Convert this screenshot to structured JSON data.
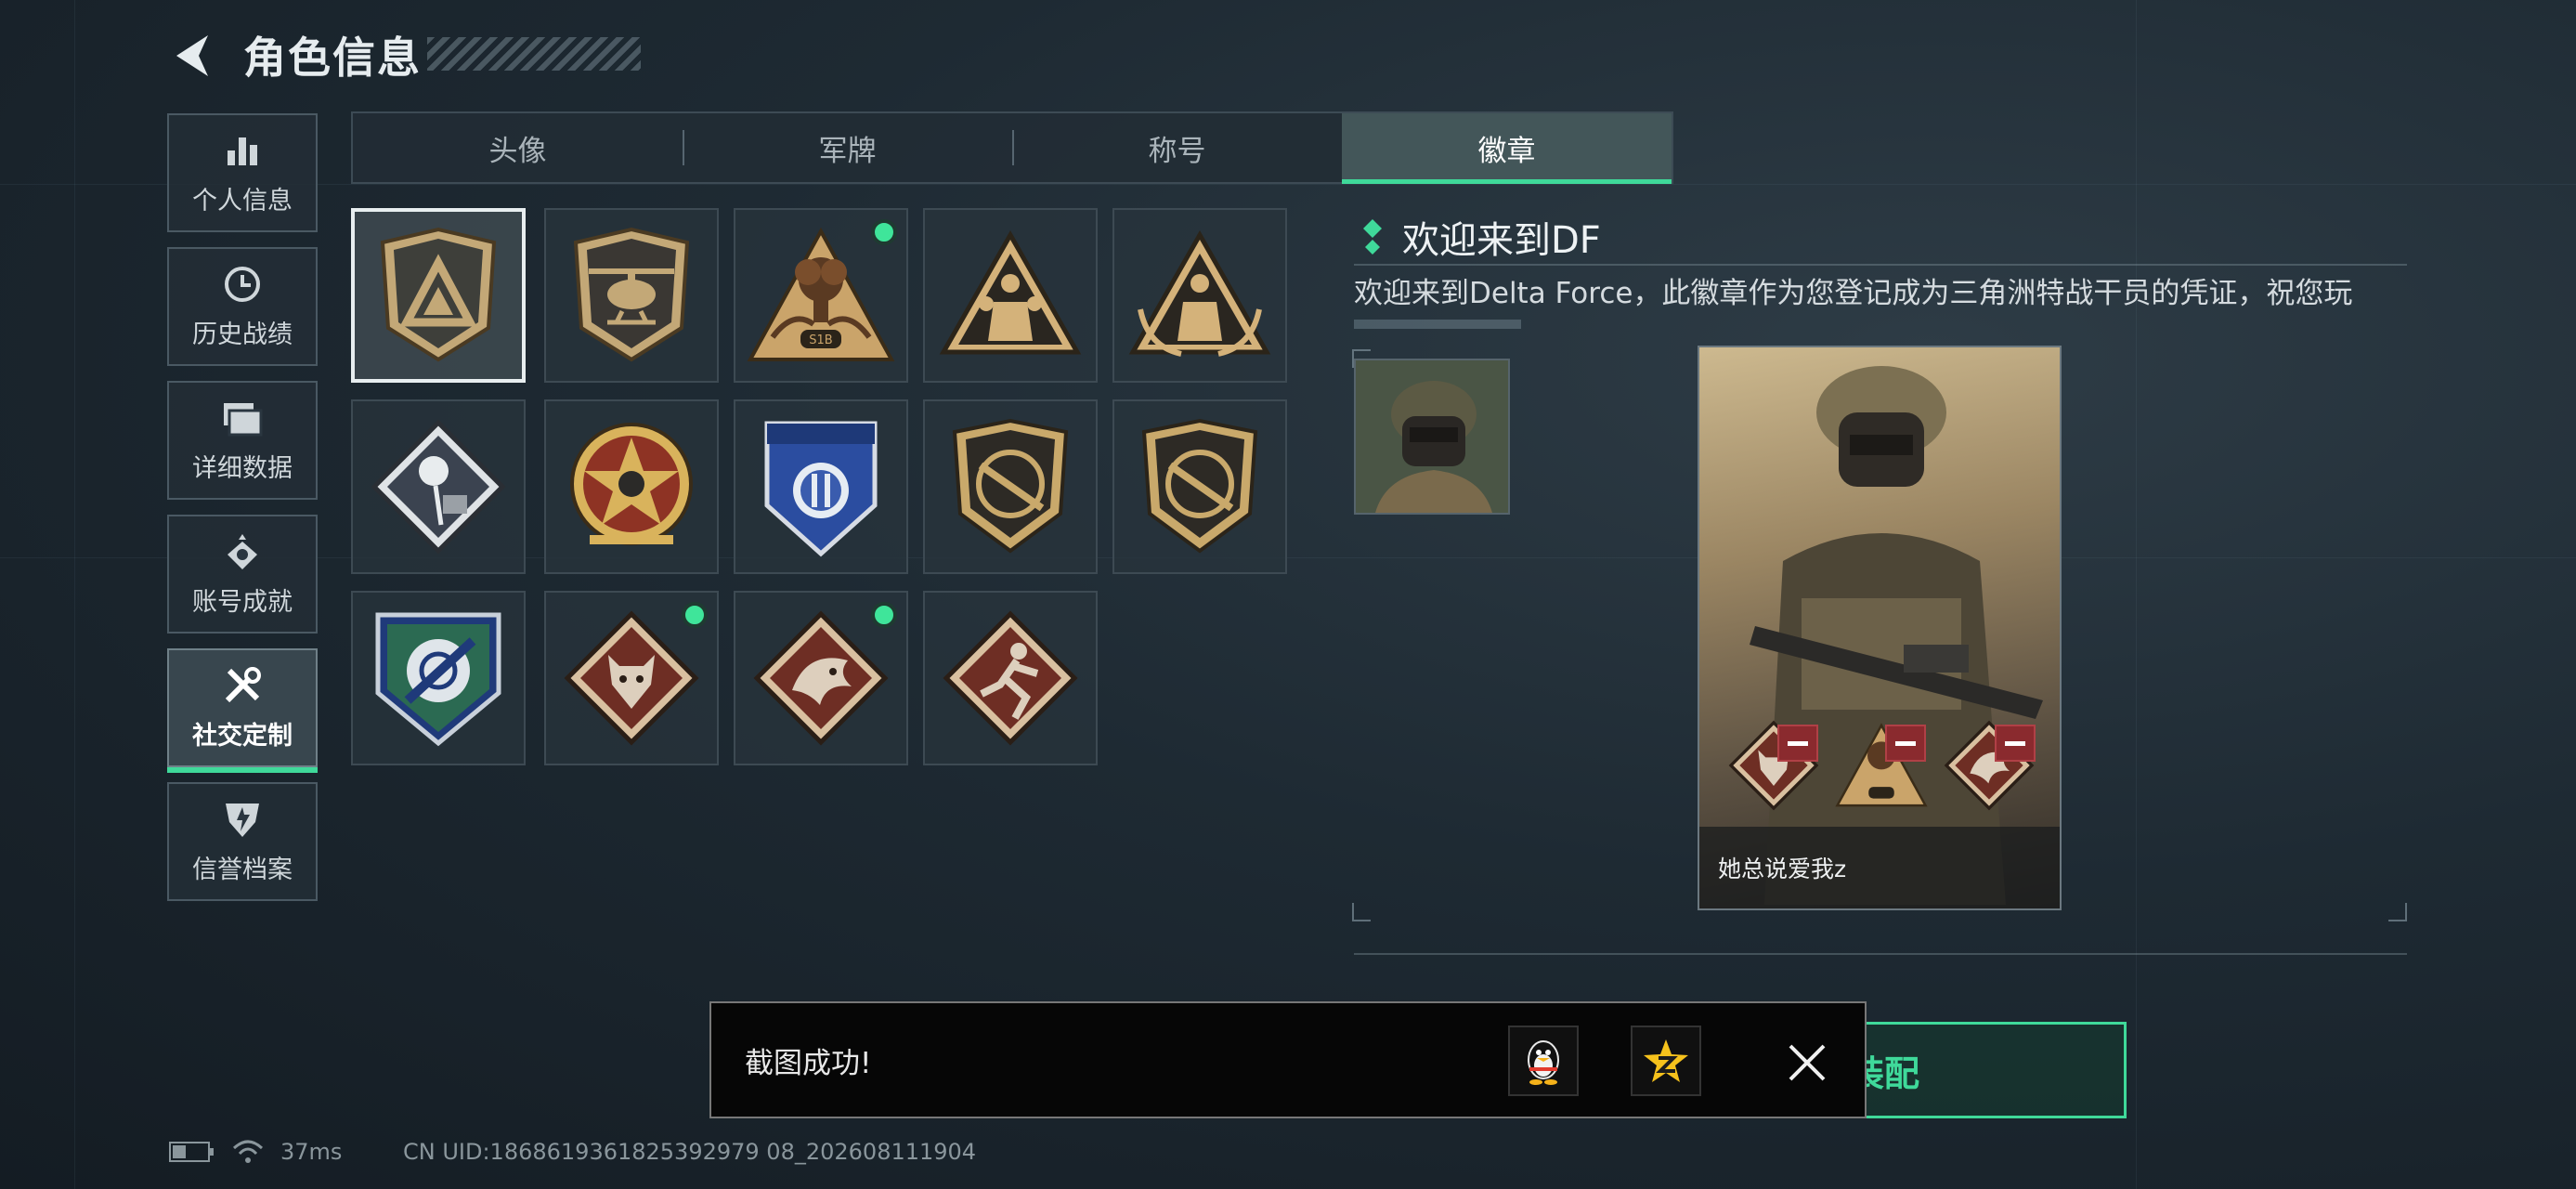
{
  "header": {
    "title": "角色信息"
  },
  "nav": [
    {
      "id": "personal",
      "label": "个人信息",
      "icon": "bar-chart-icon",
      "active": false
    },
    {
      "id": "history",
      "label": "历史战绩",
      "icon": "clock-icon",
      "active": false
    },
    {
      "id": "details",
      "label": "详细数据",
      "icon": "folder-icon",
      "active": false
    },
    {
      "id": "achievements",
      "label": "账号成就",
      "icon": "medal-icon",
      "active": false
    },
    {
      "id": "social",
      "label": "社交定制",
      "icon": "tools-icon",
      "active": true
    },
    {
      "id": "credit",
      "label": "信誉档案",
      "icon": "shield-icon",
      "active": false
    }
  ],
  "tabs": [
    {
      "label": "头像",
      "active": false
    },
    {
      "label": "军牌",
      "active": false
    },
    {
      "label": "称号",
      "active": false
    },
    {
      "label": "徽章",
      "active": true
    }
  ],
  "badges": [
    {
      "icon": "delta-triangle-shield-badge-icon",
      "selected": true,
      "new": false
    },
    {
      "icon": "helicopter-shield-badge-icon",
      "selected": false,
      "new": false
    },
    {
      "icon": "explosion-s1b-badge-icon",
      "selected": false,
      "new": true
    },
    {
      "icon": "soldiers-triangle-badge-icon",
      "selected": false,
      "new": false
    },
    {
      "icon": "soldiers-laurel-badge-icon",
      "selected": false,
      "new": false
    },
    {
      "icon": "rose-diamond-badge-icon",
      "selected": false,
      "new": false
    },
    {
      "icon": "star-roundel-badge-icon",
      "selected": false,
      "new": false
    },
    {
      "icon": "blue-shield-badge-icon",
      "selected": false,
      "new": false
    },
    {
      "icon": "rifle-shield-badge-icon",
      "selected": false,
      "new": false
    },
    {
      "icon": "rifle-shield-badge-2-icon",
      "selected": false,
      "new": false
    },
    {
      "icon": "knife-blue-shield-badge-icon",
      "selected": false,
      "new": false
    },
    {
      "icon": "wolf-diamond-badge-icon",
      "selected": false,
      "new": true
    },
    {
      "icon": "dragon-diamond-badge-icon",
      "selected": false,
      "new": true
    },
    {
      "icon": "runner-diamond-badge-icon",
      "selected": false,
      "new": false
    }
  ],
  "detail": {
    "title": "欢迎来到DF",
    "description": "欢迎来到Delta Force，此徽章作为您登记成为三角洲特战干员的凭证，祝您玩"
  },
  "card": {
    "player_name": "她总说爱我z",
    "equipped": [
      "wolf-diamond-badge-icon",
      "explosion-s1b-badge-icon",
      "dragon-diamond-badge-icon"
    ]
  },
  "equip_button": {
    "label": "装配"
  },
  "toast": {
    "message": "截图成功!",
    "share_qq": "qq-penguin-icon",
    "share_qzone": "qzone-star-icon"
  },
  "status": {
    "ping": "37ms",
    "uid": "CN UID:1868619361825392979 08_202608111904"
  },
  "colors": {
    "accent": "#3fd99a",
    "new_dot": "#3fe59a",
    "remove": "#8a2a2e"
  }
}
